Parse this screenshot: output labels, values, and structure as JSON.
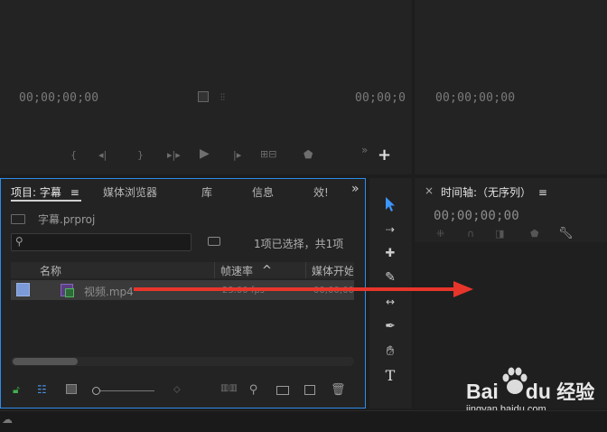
{
  "source_monitor": {
    "tc_left": "00;00;00;00",
    "tc_right": "00;00;0",
    "add_glyph": "+",
    "overflow_glyph": "»"
  },
  "program_monitor": {
    "tc": "00;00;00;00"
  },
  "project_panel": {
    "tabs": [
      "项目: 字幕",
      "媒体浏览器",
      "库",
      "信息",
      "效!"
    ],
    "tab_menu_glyph": "≡",
    "overflow_glyph": "»",
    "project_file": "字幕.prproj",
    "search_placeholder": "",
    "selection_status": "1项已选择，共1项",
    "columns": {
      "name": "名称",
      "framerate": "帧速率",
      "media_start": "媒体开始"
    },
    "sort_glyph": "^",
    "items": [
      {
        "name": "视频.mp4",
        "framerate": "23.00 fps",
        "media_start": "00;00;00"
      }
    ]
  },
  "timeline_panel": {
    "close_glyph": "×",
    "title": "时间轴:（无序列）",
    "menu_glyph": "≡",
    "tc": "00;00;00;00"
  },
  "tools": {
    "type_glyph": "T"
  },
  "watermark": {
    "brand_a": "Bai",
    "brand_b": "du",
    "brand_cn": "经验",
    "url": "jingyan.baidu.com"
  },
  "colors": {
    "accent": "#2d8ceb",
    "arrow": "#e8352b",
    "panel_bg": "#232323",
    "frame_bg": "#1d1d1d"
  }
}
